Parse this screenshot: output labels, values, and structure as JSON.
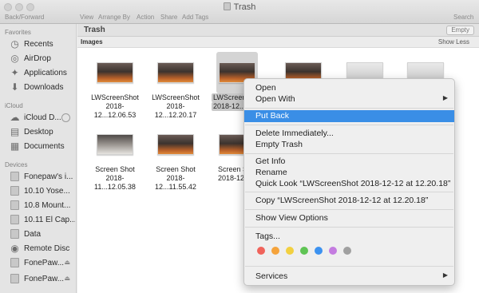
{
  "window": {
    "title": "Trash",
    "traffic_lights": [
      "close",
      "minimize",
      "zoom"
    ]
  },
  "toolbar": {
    "back_forward": "Back/Forward",
    "view": "View",
    "arrange_by": "Arrange By",
    "action": "Action",
    "share": "Share",
    "add_tags": "Add Tags",
    "search": "Search"
  },
  "sidebar": {
    "favorites_header": "Favorites",
    "favorites": [
      {
        "label": "Recents",
        "icon": "clock-icon"
      },
      {
        "label": "AirDrop",
        "icon": "airdrop-icon"
      },
      {
        "label": "Applications",
        "icon": "applications-icon"
      },
      {
        "label": "Downloads",
        "icon": "download-icon"
      }
    ],
    "icloud_header": "iCloud",
    "icloud": [
      {
        "label": "iCloud D...",
        "icon": "cloud-icon"
      },
      {
        "label": "Desktop",
        "icon": "desktop-icon"
      },
      {
        "label": "Documents",
        "icon": "document-icon"
      }
    ],
    "devices_header": "Devices",
    "devices": [
      {
        "label": "Fonepaw's i...",
        "icon": "computer-icon"
      },
      {
        "label": "10.10 Yose...",
        "icon": "disk-icon"
      },
      {
        "label": "10.8 Mount...",
        "icon": "disk-icon"
      },
      {
        "label": "10.11 El Cap...",
        "icon": "disk-icon"
      },
      {
        "label": "Data",
        "icon": "disk-icon"
      },
      {
        "label": "Remote Disc",
        "icon": "disc-icon"
      },
      {
        "label": "FonePaw...",
        "icon": "disk-icon"
      },
      {
        "label": "FonePaw...",
        "icon": "disk-icon"
      }
    ]
  },
  "pathbar": {
    "title": "Trash",
    "empty_button": "Empty"
  },
  "group": {
    "title": "Images",
    "show_less": "Show Less"
  },
  "files": [
    {
      "line1": "LWScreenShot",
      "line2": "2018-12...12.06.53",
      "thumb": "mountain"
    },
    {
      "line1": "LWScreenShot",
      "line2": "2018-12...12.20.17",
      "thumb": "mountain"
    },
    {
      "line1": "LWScreen",
      "line2": "2018-12...1",
      "thumb": "mountain"
    },
    {
      "line1": "",
      "line2": "",
      "thumb": "mountain"
    },
    {
      "line1": "",
      "line2": "",
      "thumb": "doc"
    },
    {
      "line1": "",
      "line2": "",
      "thumb": "doc"
    },
    {
      "line1": "Screen Shot",
      "line2": "2018-11...12.05.38",
      "thumb": "snow"
    },
    {
      "line1": "Screen Shot",
      "line2": "2018-12...11.55.42",
      "thumb": "mountain"
    },
    {
      "line1": "Screen S",
      "line2": "2018-12...1",
      "thumb": "mountain"
    }
  ],
  "context_menu": {
    "items": [
      {
        "label": "Open",
        "submenu": false
      },
      {
        "label": "Open With",
        "submenu": true
      },
      {
        "label": "Put Back",
        "submenu": false,
        "highlighted": true
      },
      {
        "label": "Delete Immediately...",
        "submenu": false
      },
      {
        "label": "Empty Trash",
        "submenu": false
      },
      {
        "label": "Get Info",
        "submenu": false
      },
      {
        "label": "Rename",
        "submenu": false
      },
      {
        "label": "Quick Look “LWScreenShot 2018-12-12 at 12.20.18”",
        "submenu": false
      },
      {
        "label": "Copy “LWScreenShot 2018-12-12 at 12.20.18”",
        "submenu": false
      },
      {
        "label": "Show View Options",
        "submenu": false
      },
      {
        "label": "Tags...",
        "submenu": false
      },
      {
        "label": "Services",
        "submenu": true
      }
    ],
    "tag_colors": [
      "#f0635b",
      "#f5a33b",
      "#f2d040",
      "#5fc454",
      "#3c92f0",
      "#c47ce0",
      "#a0a0a0"
    ]
  },
  "colors": {
    "highlight": "#3a8ee6",
    "sidebar_bg": "#e4e4e4"
  }
}
